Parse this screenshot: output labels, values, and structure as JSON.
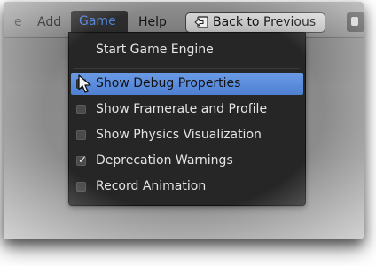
{
  "menubar": {
    "left_fragment": "e",
    "add": "Add",
    "game": "Game",
    "help": "Help",
    "back_to_previous": "Back to Previous",
    "back_icon": "back-arrow-icon",
    "corner_icon": "editor-type-icon"
  },
  "game_menu": {
    "start": "Start Game Engine",
    "items": [
      {
        "label": "Show Debug Properties",
        "checked": true,
        "highlighted": true
      },
      {
        "label": "Show Framerate and Profile",
        "checked": false
      },
      {
        "label": "Show Physics Visualization",
        "checked": false
      },
      {
        "label": "Deprecation Warnings",
        "checked": true
      },
      {
        "label": "Record Animation",
        "checked": false
      }
    ]
  },
  "colors": {
    "menu_bg": "#262626",
    "highlight": "#5b8ddb",
    "active_menu_text": "#4f82d8",
    "menubar": "#8a8a8a"
  }
}
